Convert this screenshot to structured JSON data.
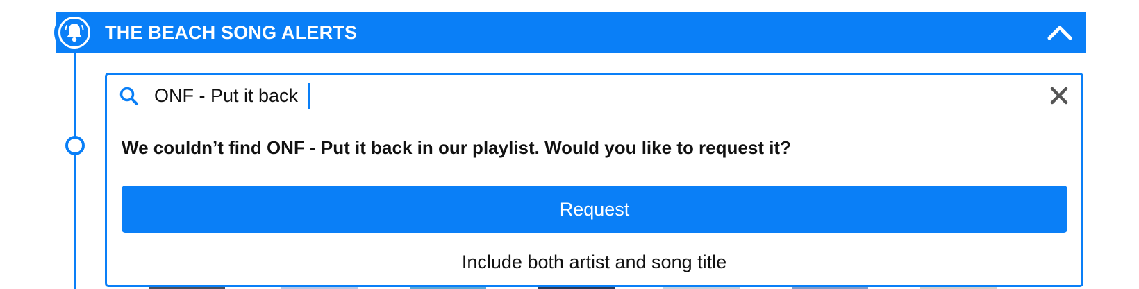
{
  "header": {
    "title": "THE BEACH SONG ALERTS",
    "icon": "bell-icon",
    "collapse_icon": "chevron-up-icon"
  },
  "search": {
    "value": "ONF - Put it back",
    "icon": "search-icon",
    "clear_icon": "close-icon"
  },
  "result": {
    "message": "We couldn’t find ONF - Put it back in our playlist. Would you like to request it?",
    "request_label": "Request",
    "hint": "Include both artist and song title"
  },
  "colors": {
    "accent": "#0a7ff7",
    "text": "#111111",
    "icon_gray": "#555555"
  }
}
